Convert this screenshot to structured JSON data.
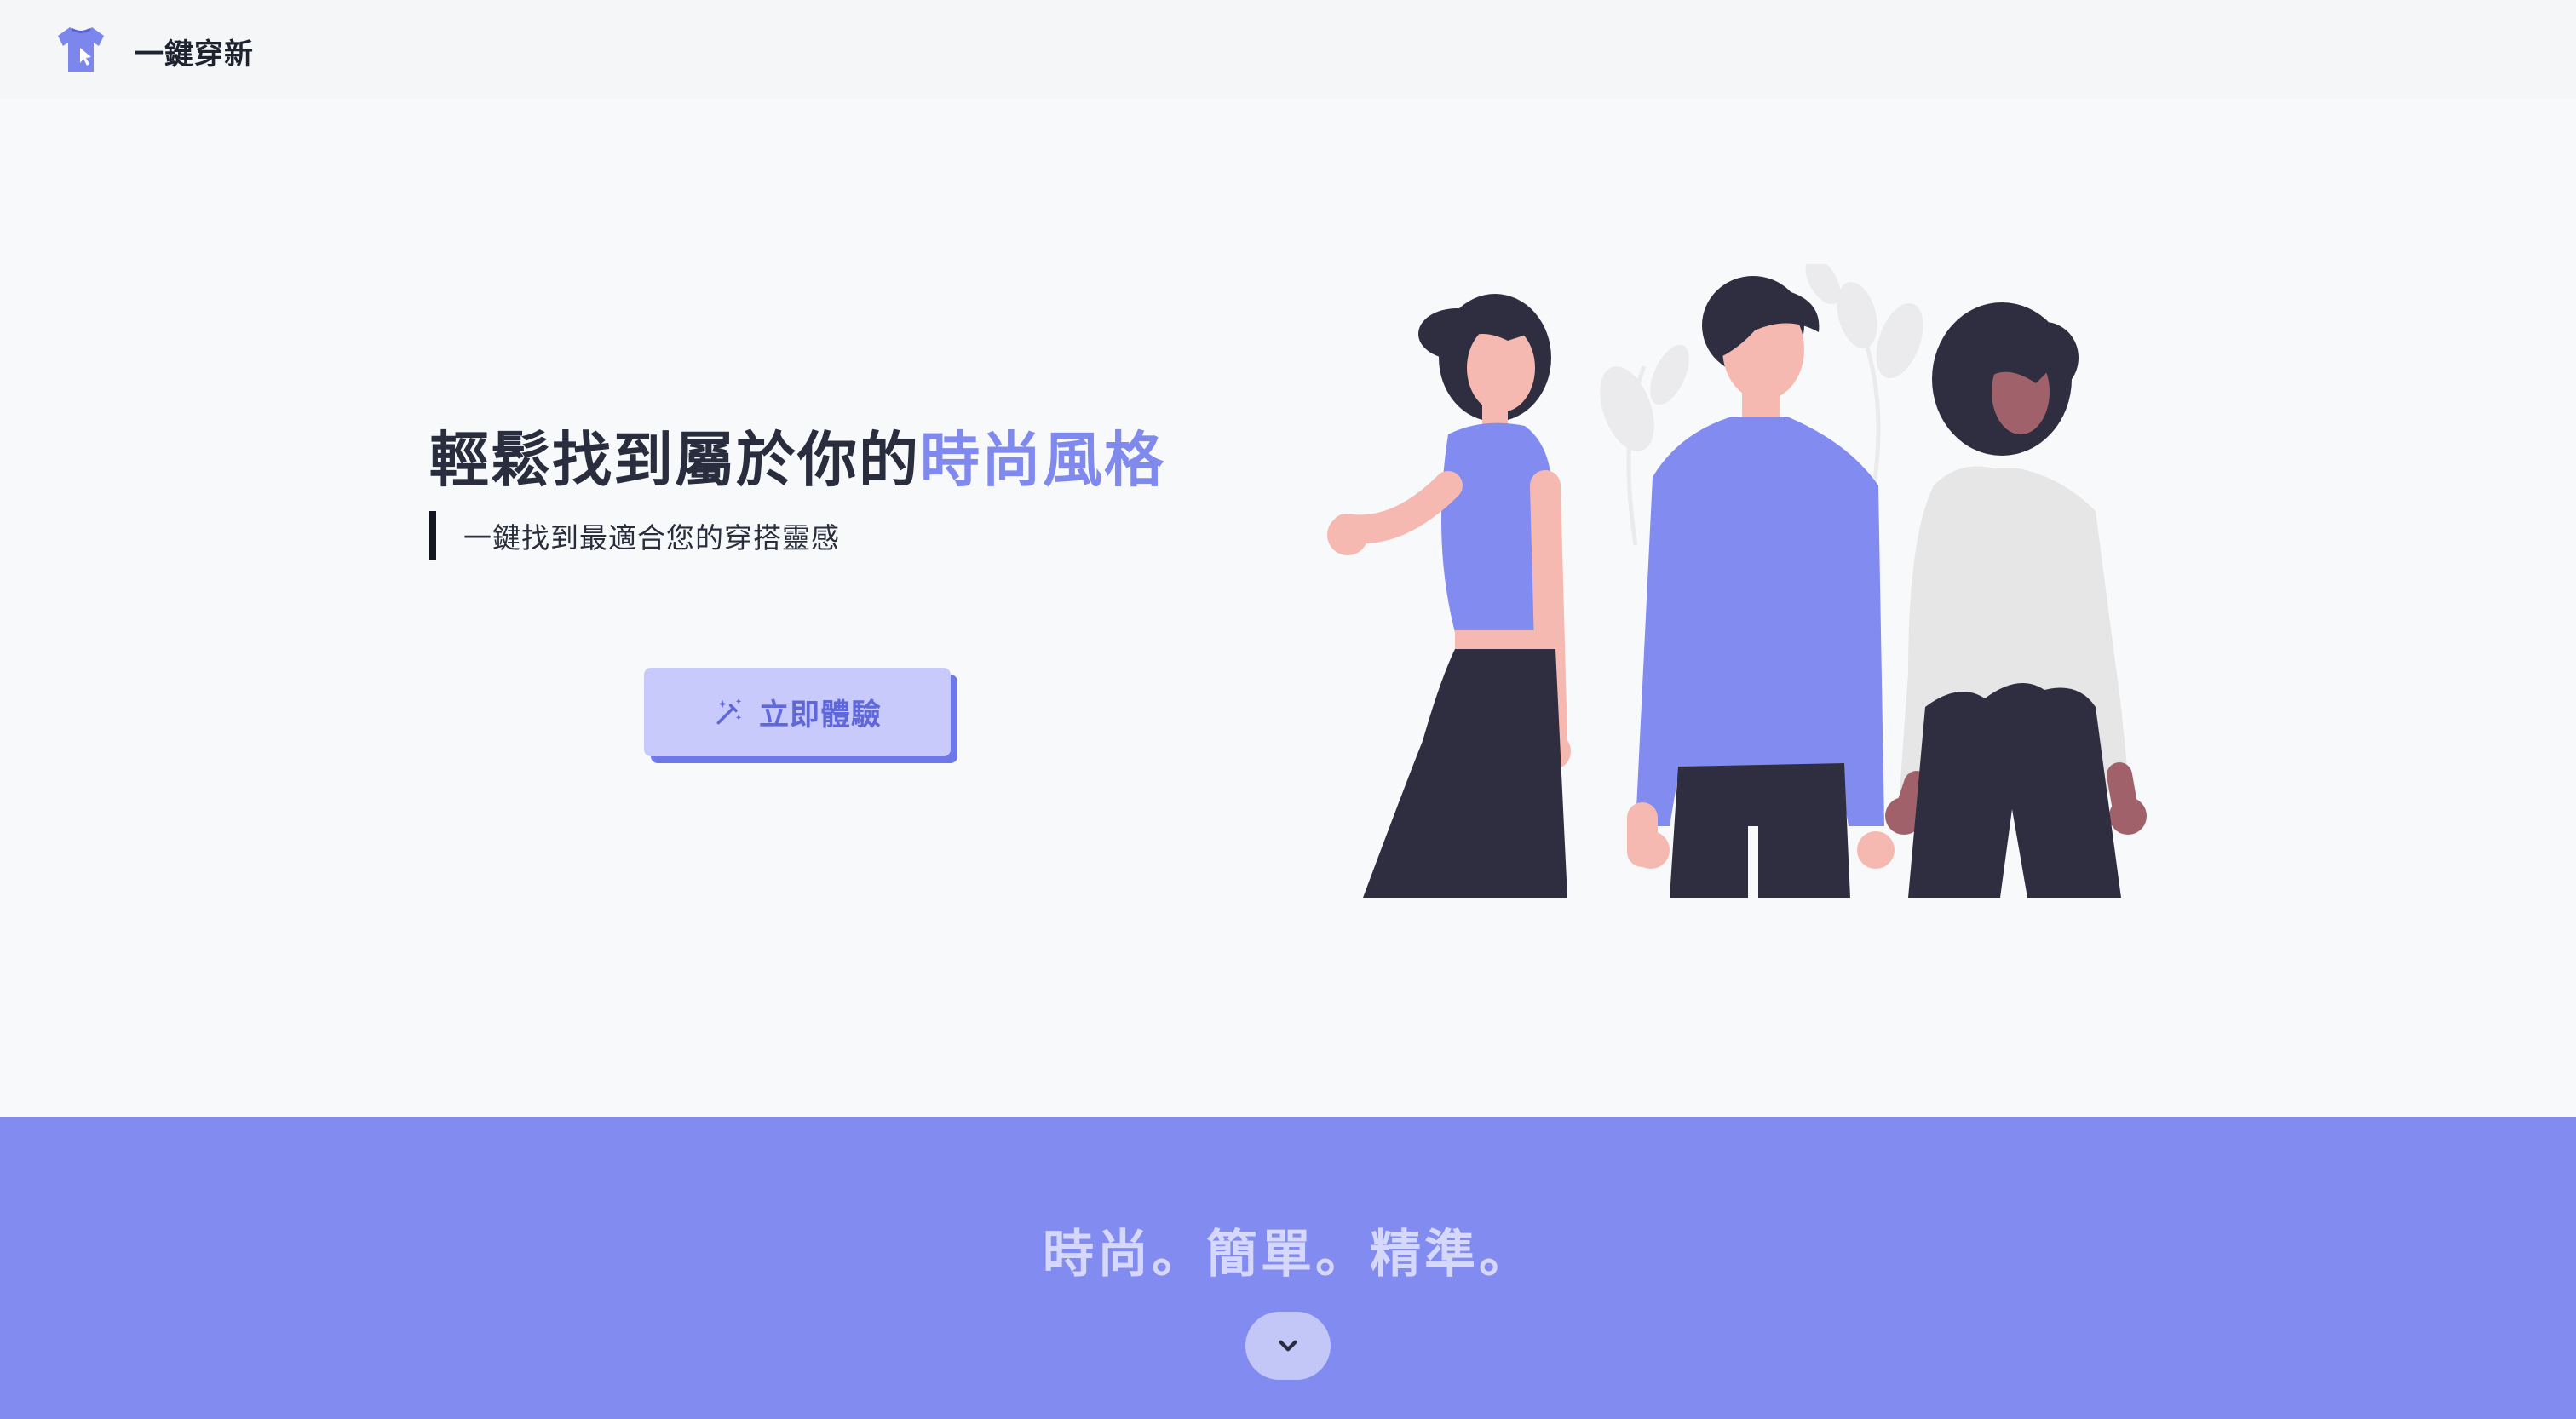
{
  "navbar": {
    "brand": "一鍵穿新",
    "logo_icon": "tshirt-cursor-icon"
  },
  "hero": {
    "title_main": "輕鬆找到屬於你的",
    "title_accent": "時尚風格",
    "subtitle": "一鍵找到最適合您的穿搭靈感",
    "cta_label": "立即體驗",
    "cta_icon": "magic-wand-icon",
    "illustration": "three-people-illustration"
  },
  "band": {
    "slogan": "時尚。簡單。精準。",
    "scroll_icon": "chevron-down-icon"
  },
  "colors": {
    "accent": "#828bef",
    "button_bg": "#c7cafa",
    "button_shadow": "#6f78ea",
    "title": "#2a2d3d"
  }
}
